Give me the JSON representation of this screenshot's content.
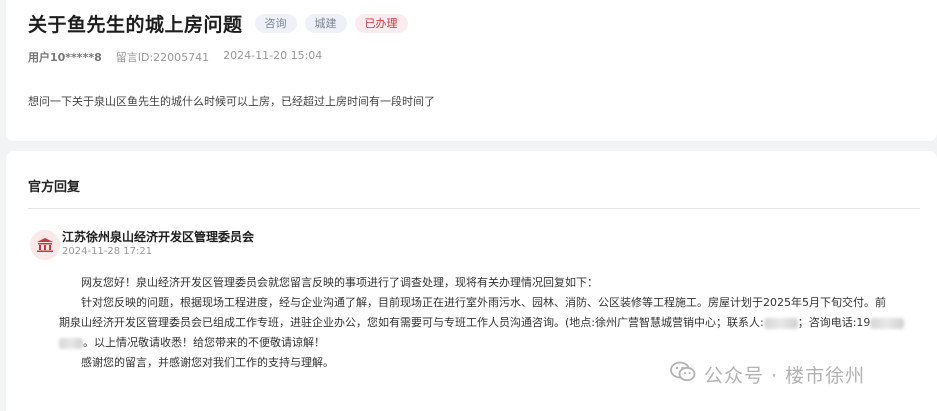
{
  "question": {
    "title": "关于鱼先生的城上房问题",
    "tags": [
      "咨询",
      "城建",
      "已办理"
    ],
    "user": "用户10*****8",
    "message_id": "留言ID:22005741",
    "time": "2024-11-20 15:04",
    "content": "想问一下关于泉山区鱼先生的城什么时候可以上房，已经超过上房时间有一段时间了"
  },
  "reply_section": {
    "heading": "官方回复",
    "org_icon": "government-building-icon",
    "org_name": "江苏徐州泉山经济开发区管理委员会",
    "reply_time": "2024-11-28 17:21",
    "p1": "网友您好！泉山经济开发区管理委员会就您留言反映的事项进行了调查处理，现将有关办理情况回复如下：",
    "p2": "针对您反映的问题，根据现场工程进度，经与企业沟通了解，目前现场正在进行室外雨污水、园林、消防、公区装修等工程施工。房屋计划于2025年5月下旬交付。前",
    "p3_a": "期泉山经济开发区管理委员会已组成工作专班，进驻企业办公，您如有需要可与专班工作人员沟通咨询。(地点:徐州广营智慧城营销中心；联系人:",
    "p3_b": "；咨询电话:19",
    "p4": "。以上情况敬请收悉！给您带来的不便敬请谅解！",
    "p5": "感谢您的留言，并感谢您对我们工作的支持与理解。"
  },
  "watermark": {
    "icon": "wechat-icon",
    "text": "公众号 · 楼市徐州"
  }
}
